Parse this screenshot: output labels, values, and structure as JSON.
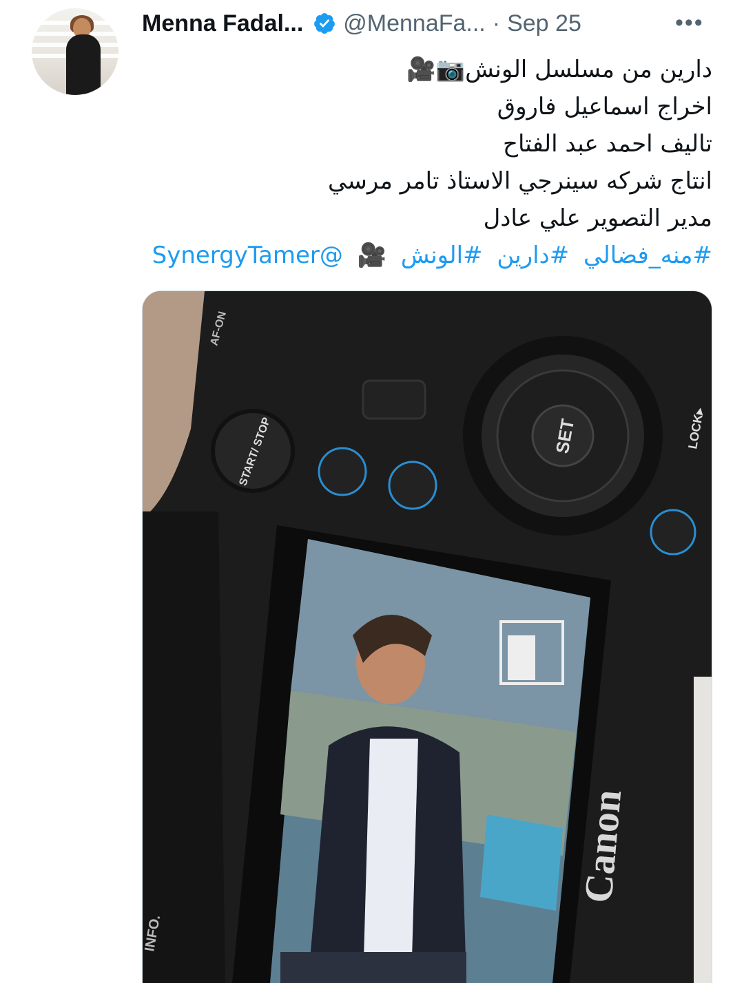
{
  "user": {
    "name": "Menna Fadal...",
    "handle": "@MennaFa...",
    "separator": "·",
    "date": "Sep 25",
    "more_label": "•••",
    "verified_color": "#1d9bf0"
  },
  "tweet": {
    "lines": [
      "دارين من مسلسل الونش📷🎥",
      "اخراج اسماعيل فاروق",
      "تاليف احمد عبد الفتاح",
      "انتاج شركه سينرجي الاستاذ تامر مرسي",
      "مدير التصوير علي عادل"
    ],
    "hashtags": [
      "#منه_فضالي",
      "#دارين",
      "#الونش"
    ],
    "camera_emoji": "🎥",
    "mention": "@SynergyTamer",
    "link_color": "#1d9bf0"
  },
  "media": {
    "camera_labels": {
      "af_on": "AF-ON",
      "start_stop": "START/ STOP",
      "set": "SET",
      "lock": "LOCK▸",
      "brand": "Canon",
      "info": "INFO."
    }
  }
}
